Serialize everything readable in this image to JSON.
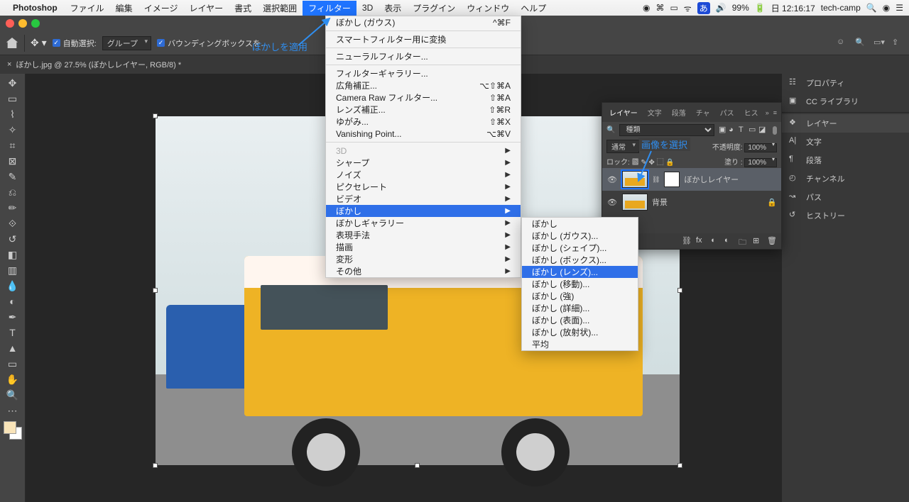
{
  "mac": {
    "app": "Photoshop",
    "menus": [
      "ファイル",
      "編集",
      "イメージ",
      "レイヤー",
      "書式",
      "選択範囲",
      "フィルター",
      "3D",
      "表示",
      "プラグイン",
      "ウィンドウ",
      "ヘルプ"
    ],
    "active_menu_index": 6,
    "battery": "99%",
    "clock": "日 12:16:17",
    "user": "tech-camp"
  },
  "options": {
    "auto_select_label": "自動選択:",
    "group_dropdown": "グループ",
    "bbox_label": "バウンディングボックスを…"
  },
  "annot": {
    "apply_blur": "ぼかしを適用",
    "select_image": "画像を選択"
  },
  "tab": {
    "title": "ぼかし.jpg @ 27.5% (ぼかしレイヤー, RGB/8) *"
  },
  "filter_menu": {
    "last": {
      "label": "ぼかし (ガウス)",
      "shortcut": "^⌘F"
    },
    "convert_smart": "スマートフィルター用に変換",
    "neural": "ニューラルフィルター...",
    "gallery": "フィルターギャラリー...",
    "wide": {
      "label": "広角補正...",
      "shortcut": "⌥⇧⌘A"
    },
    "cameraraw": {
      "label": "Camera Raw フィルター...",
      "shortcut": "⇧⌘A"
    },
    "lens": {
      "label": "レンズ補正...",
      "shortcut": "⇧⌘R"
    },
    "liquify": {
      "label": "ゆがみ...",
      "shortcut": "⇧⌘X"
    },
    "vanishing": {
      "label": "Vanishing Point...",
      "shortcut": "⌥⌘V"
    },
    "threeD": "3D",
    "sharpen": "シャープ",
    "noise": "ノイズ",
    "pixelate": "ピクセレート",
    "video": "ビデオ",
    "blur": "ぼかし",
    "blur_gallery": "ぼかしギャラリー",
    "stylize": "表現手法",
    "render": "描画",
    "distort": "変形",
    "other": "その他"
  },
  "blur_submenu": {
    "items": [
      "ぼかし",
      "ぼかし (ガウス)...",
      "ぼかし (シェイプ)...",
      "ぼかし (ボックス)...",
      "ぼかし (レンズ)...",
      "ぼかし (移動)...",
      "ぼかし (強)",
      "ぼかし (詳細)...",
      "ぼかし (表面)...",
      "ぼかし (放射状)...",
      "平均"
    ],
    "highlight_index": 4
  },
  "right_dock": {
    "items": [
      "プロパティ",
      "CC ライブラリ",
      "レイヤー",
      "文字",
      "段落",
      "チャンネル",
      "パス",
      "ヒストリー"
    ]
  },
  "layers": {
    "tabs": [
      "レイヤー",
      "文字",
      "段落",
      "チャ",
      "パス",
      "ヒス"
    ],
    "kind_label": "種類",
    "blend_mode": "通常",
    "opacity_label": "不透明度:",
    "opacity_value": "100%",
    "lock_label": "ロック:",
    "fill_label": "塗り :",
    "fill_value": "100%",
    "layer1": "ぼかしレイヤー",
    "layer2": "背景"
  },
  "swatch_fg": "#f9e4b9"
}
